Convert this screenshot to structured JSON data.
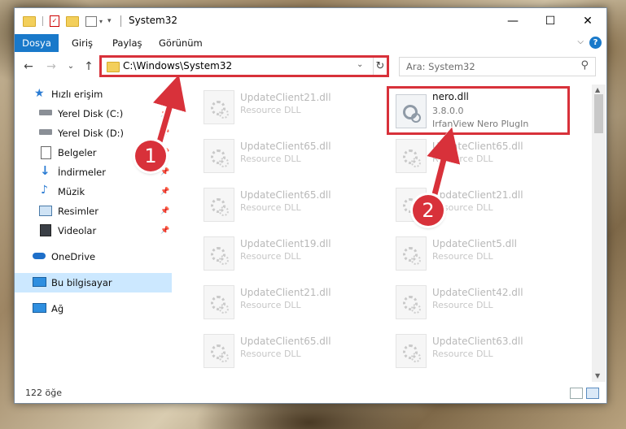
{
  "window": {
    "title": "System32",
    "controls": {
      "minimize": "—",
      "maximize": "☐",
      "close": "✕"
    }
  },
  "ribbon": {
    "tabs": [
      "Dosya",
      "Giriş",
      "Paylaş",
      "Görünüm"
    ],
    "help": "?",
    "expand": "⌵"
  },
  "nav": {
    "back": "←",
    "forward": "→",
    "recent": "⌄",
    "up": "↑",
    "address": "C:\\Windows\\System32",
    "address_dropdown": "⌄",
    "refresh": "↻",
    "search_placeholder": "Ara: System32",
    "search_icon": "⚲"
  },
  "sidebar": {
    "items": [
      {
        "label": "Hızlı erişim",
        "icon": "star-icon"
      },
      {
        "label": "Yerel Disk (C:)",
        "icon": "drive-icon",
        "pinned": true
      },
      {
        "label": "Yerel Disk (D:)",
        "icon": "drive-icon",
        "pinned": true
      },
      {
        "label": "Belgeler",
        "icon": "documents-icon",
        "pinned": true
      },
      {
        "label": "İndirmeler",
        "icon": "download-icon",
        "pinned": true
      },
      {
        "label": "Müzik",
        "icon": "music-icon",
        "pinned": true
      },
      {
        "label": "Resimler",
        "icon": "pictures-icon",
        "pinned": true
      },
      {
        "label": "Videolar",
        "icon": "videos-icon",
        "pinned": true
      },
      {
        "label": "OneDrive",
        "icon": "cloud-icon"
      },
      {
        "label": "Bu bilgisayar",
        "icon": "computer-icon",
        "selected": true
      },
      {
        "label": "Ağ",
        "icon": "network-icon"
      }
    ]
  },
  "files": {
    "left": [
      {
        "name": "UpdateClient21.dll",
        "desc": "Resource DLL"
      },
      {
        "name": "UpdateClient65.dll",
        "desc": "Resource DLL"
      },
      {
        "name": "UpdateClient65.dll",
        "desc": "Resource DLL"
      },
      {
        "name": "UpdateClient19.dll",
        "desc": "Resource DLL"
      },
      {
        "name": "UpdateClient21.dll",
        "desc": "Resource DLL"
      },
      {
        "name": "UpdateClient65.dll",
        "desc": "Resource DLL"
      }
    ],
    "right": [
      {
        "name": "nero.dll",
        "version": "3.8.0.0",
        "desc": "IrfanView Nero PlugIn",
        "highlighted": true
      },
      {
        "name": "UpdateClient65.dll",
        "desc": "Resource DLL"
      },
      {
        "name": "UpdateClient21.dll",
        "desc": "Resource DLL"
      },
      {
        "name": "UpdateClient5.dll",
        "desc": "Resource DLL"
      },
      {
        "name": "UpdateClient42.dll",
        "desc": "Resource DLL"
      },
      {
        "name": "UpdateClient63.dll",
        "desc": "Resource DLL"
      }
    ]
  },
  "status": {
    "count": "122 öğe"
  },
  "annotations": [
    {
      "number": "1",
      "color": "#d8313a"
    },
    {
      "number": "2",
      "color": "#d8313a"
    }
  ],
  "colors": {
    "accent": "#1979ca",
    "selection": "#cce8ff",
    "annotation_red": "#d8313a"
  }
}
